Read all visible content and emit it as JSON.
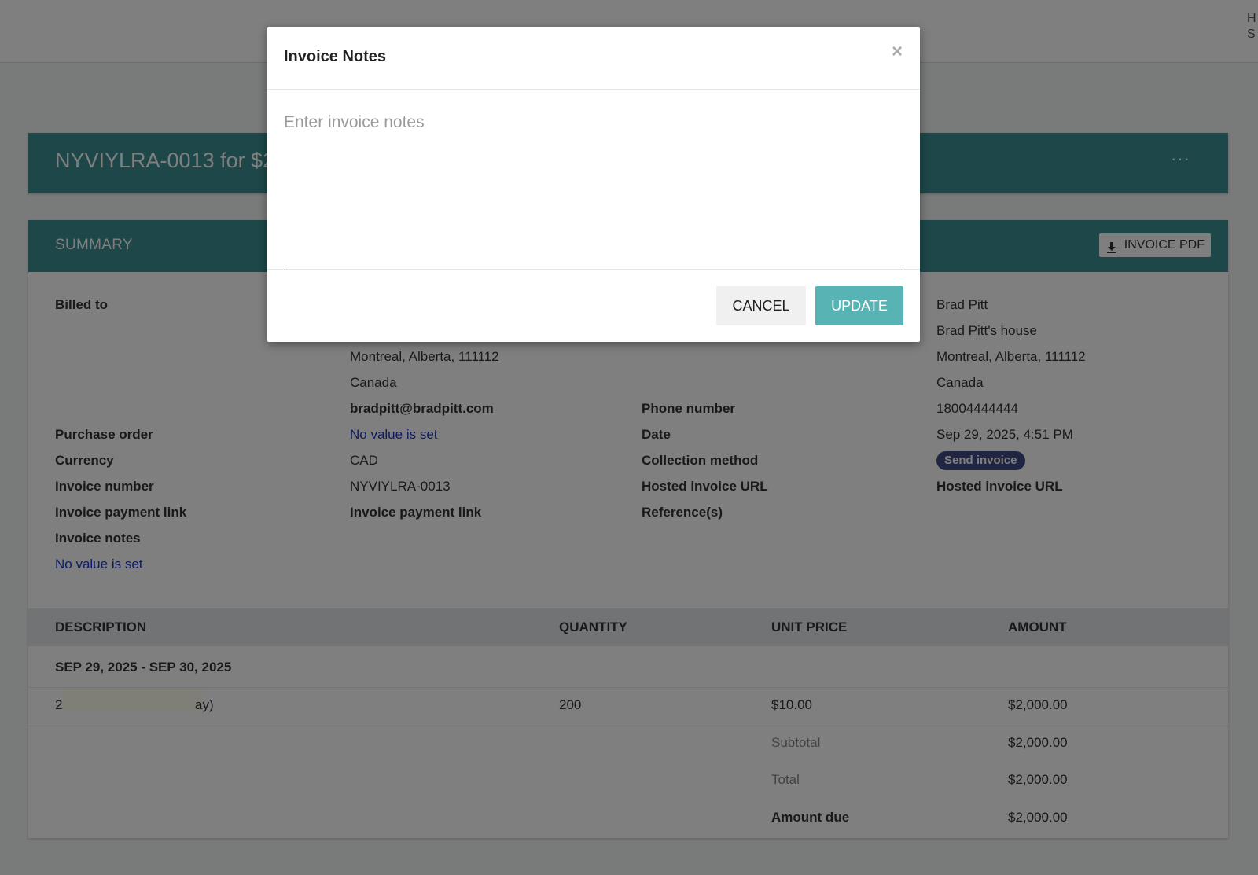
{
  "topbar": {
    "corner_line1": "H",
    "corner_line2": "S"
  },
  "header": {
    "title": "NYVIYLRA-0013 for $2",
    "more": "···"
  },
  "summary": {
    "title": "SUMMARY",
    "pdf_label": "INVOICE PDF",
    "billed_to_label": "Billed to",
    "billed_address": "Montreal, Alberta, 111112",
    "billed_country": "Canada",
    "billed_email": "bradpitt@bradpitt.com",
    "ship_name": "Brad Pitt",
    "ship_house": "Brad Pitt's house",
    "ship_address": "Montreal, Alberta, 111112",
    "ship_country": "Canada",
    "phone_label": "Phone number",
    "phone_value": "18004444444",
    "purchase_order_label": "Purchase order",
    "purchase_order_value": "No value is set",
    "date_label": "Date",
    "date_value": "Sep 29, 2025, 4:51 PM",
    "currency_label": "Currency",
    "currency_value": "CAD",
    "collection_label": "Collection method",
    "collection_value": "Send invoice",
    "invoice_number_label": "Invoice number",
    "invoice_number_value": "NYVIYLRA-0013",
    "hosted_url_label": "Hosted invoice URL",
    "hosted_url_value": "Hosted invoice URL",
    "payment_link_label": "Invoice payment link",
    "payment_link_value": "Invoice payment link",
    "references_label": "Reference(s)",
    "notes_label": "Invoice notes",
    "notes_value": "No value is set"
  },
  "table": {
    "headers": [
      "DESCRIPTION",
      "QUANTITY",
      "UNIT PRICE",
      "AMOUNT"
    ],
    "period": "SEP 29, 2025 - SEP 30, 2025",
    "item": {
      "desc_prefix": "2",
      "desc_suffix": "ay)",
      "quantity": "200",
      "unit_price": "$10.00",
      "amount": "$2,000.00"
    },
    "subtotal_label": "Subtotal",
    "subtotal_value": "$2,000.00",
    "total_label": "Total",
    "total_value": "$2,000.00",
    "amount_due_label": "Amount due",
    "amount_due_value": "$2,000.00"
  },
  "modal": {
    "title": "Invoice Notes",
    "close": "×",
    "placeholder": "Enter invoice notes",
    "cancel": "CANCEL",
    "update": "UPDATE"
  },
  "colors": {
    "teal": "#3a8f91",
    "update": "#57b3b4",
    "link": "#1d37c9",
    "badge": "#414b82"
  }
}
